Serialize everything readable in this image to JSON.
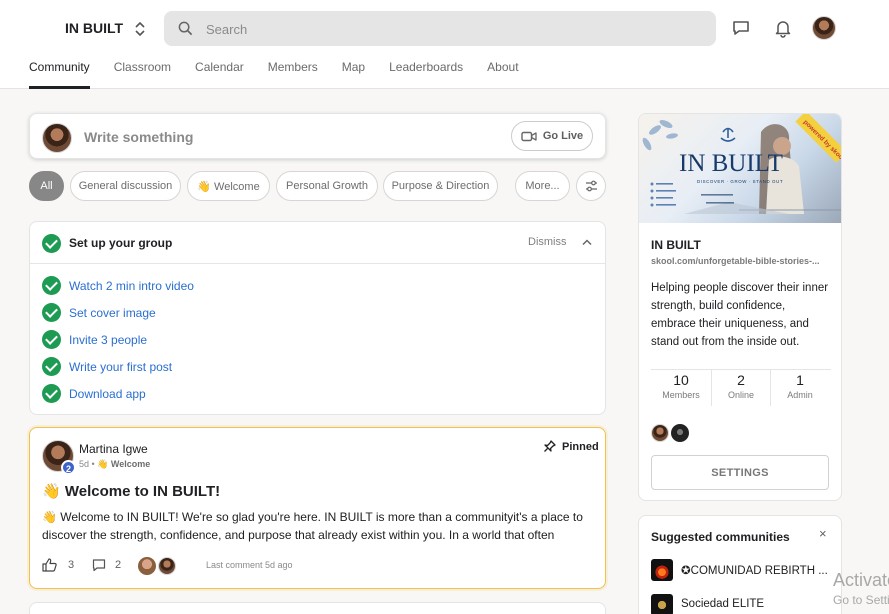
{
  "header": {
    "brand": "IN BUILT",
    "search_placeholder": "Search",
    "icons": [
      "chat-icon",
      "bell-icon",
      "avatar-icon"
    ]
  },
  "tabs": [
    {
      "label": "Community",
      "active": true
    },
    {
      "label": "Classroom",
      "active": false
    },
    {
      "label": "Calendar",
      "active": false
    },
    {
      "label": "Members",
      "active": false
    },
    {
      "label": "Map",
      "active": false
    },
    {
      "label": "Leaderboards",
      "active": false
    },
    {
      "label": "About",
      "active": false
    }
  ],
  "composer": {
    "placeholder": "Write something",
    "go_live": "Go Live"
  },
  "chips": [
    {
      "label": "All",
      "active": true
    },
    {
      "label": "General discussion",
      "active": false
    },
    {
      "label": "👋 Welcome",
      "active": false
    },
    {
      "label": "Personal Growth",
      "active": false
    },
    {
      "label": "Purpose & Direction",
      "active": false
    },
    {
      "label": "More...",
      "active": false
    }
  ],
  "setup": {
    "title": "Set up your group",
    "dismiss": "Dismiss",
    "tasks": [
      "Watch 2 min intro video",
      "Set cover image",
      "Invite 3 people",
      "Write your first post",
      "Download app"
    ]
  },
  "post": {
    "author": "Martina Igwe",
    "level": "2",
    "age": "5d",
    "separator": "•",
    "category": "👋 Welcome",
    "pinned": "Pinned",
    "title": "👋 Welcome to IN BUILT!",
    "body_line1": "👋 Welcome to IN BUILT! We're so glad you're here. IN BUILT is more than a communityit's a place to",
    "body_line2": "discover the strength, confidence, and purpose that already exist within you. In a world that often",
    "likes": "3",
    "comments": "2",
    "last_comment": "Last comment 5d ago"
  },
  "group": {
    "cover_text": {
      "badge": "powered by skool",
      "logo": "IN BUILT",
      "tagline": "DISCOVER · GROW · STAND OUT"
    },
    "name": "IN BUILT",
    "url": "skool.com/unforgetable-bible-stories-...",
    "description": "Helping people discover their inner strength, build confidence, embrace their uniqueness, and stand out from the inside out.",
    "stats": [
      {
        "value": "10",
        "label": "Members"
      },
      {
        "value": "2",
        "label": "Online"
      },
      {
        "value": "1",
        "label": "Admin"
      }
    ],
    "settings": "SETTINGS"
  },
  "suggested": {
    "title": "Suggested communities",
    "close": "×",
    "items": [
      {
        "name": "✪COMUNIDAD REBIRTH ..."
      },
      {
        "name": "Sociedad ELITE"
      }
    ]
  },
  "watermark": {
    "line1": "Activate Windows",
    "line2": "Go to Settings to activate Windows."
  },
  "colors": {
    "accent": "#1d9b52",
    "link": "#2b6fcf",
    "pinned_border": "#f0c24b",
    "level_badge": "#3e63c8"
  }
}
